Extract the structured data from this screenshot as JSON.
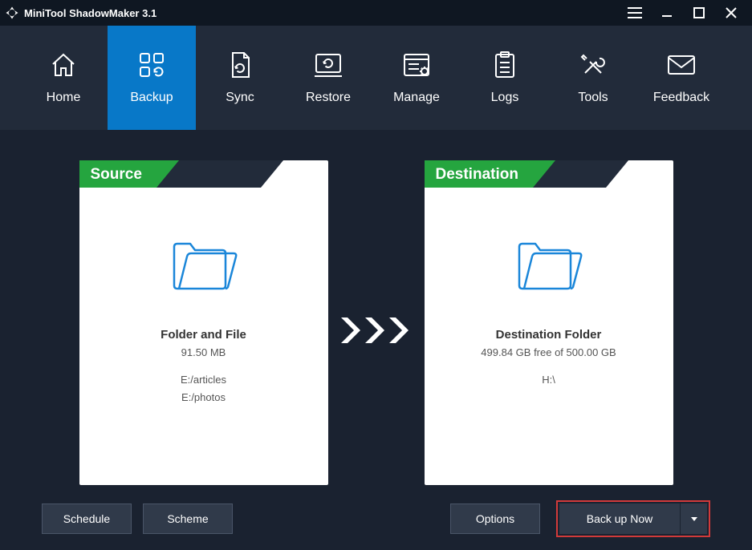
{
  "titlebar": {
    "title": "MiniTool ShadowMaker 3.1"
  },
  "nav": {
    "items": [
      {
        "label": "Home"
      },
      {
        "label": "Backup"
      },
      {
        "label": "Sync"
      },
      {
        "label": "Restore"
      },
      {
        "label": "Manage"
      },
      {
        "label": "Logs"
      },
      {
        "label": "Tools"
      },
      {
        "label": "Feedback"
      }
    ]
  },
  "source": {
    "header": "Source",
    "title": "Folder and File",
    "size": "91.50 MB",
    "paths": [
      "E:/articles",
      "E:/photos"
    ]
  },
  "destination": {
    "header": "Destination",
    "title": "Destination Folder",
    "free": "499.84 GB free of 500.00 GB",
    "path": "H:\\"
  },
  "buttons": {
    "schedule": "Schedule",
    "scheme": "Scheme",
    "options": "Options",
    "backupNow": "Back up Now"
  }
}
